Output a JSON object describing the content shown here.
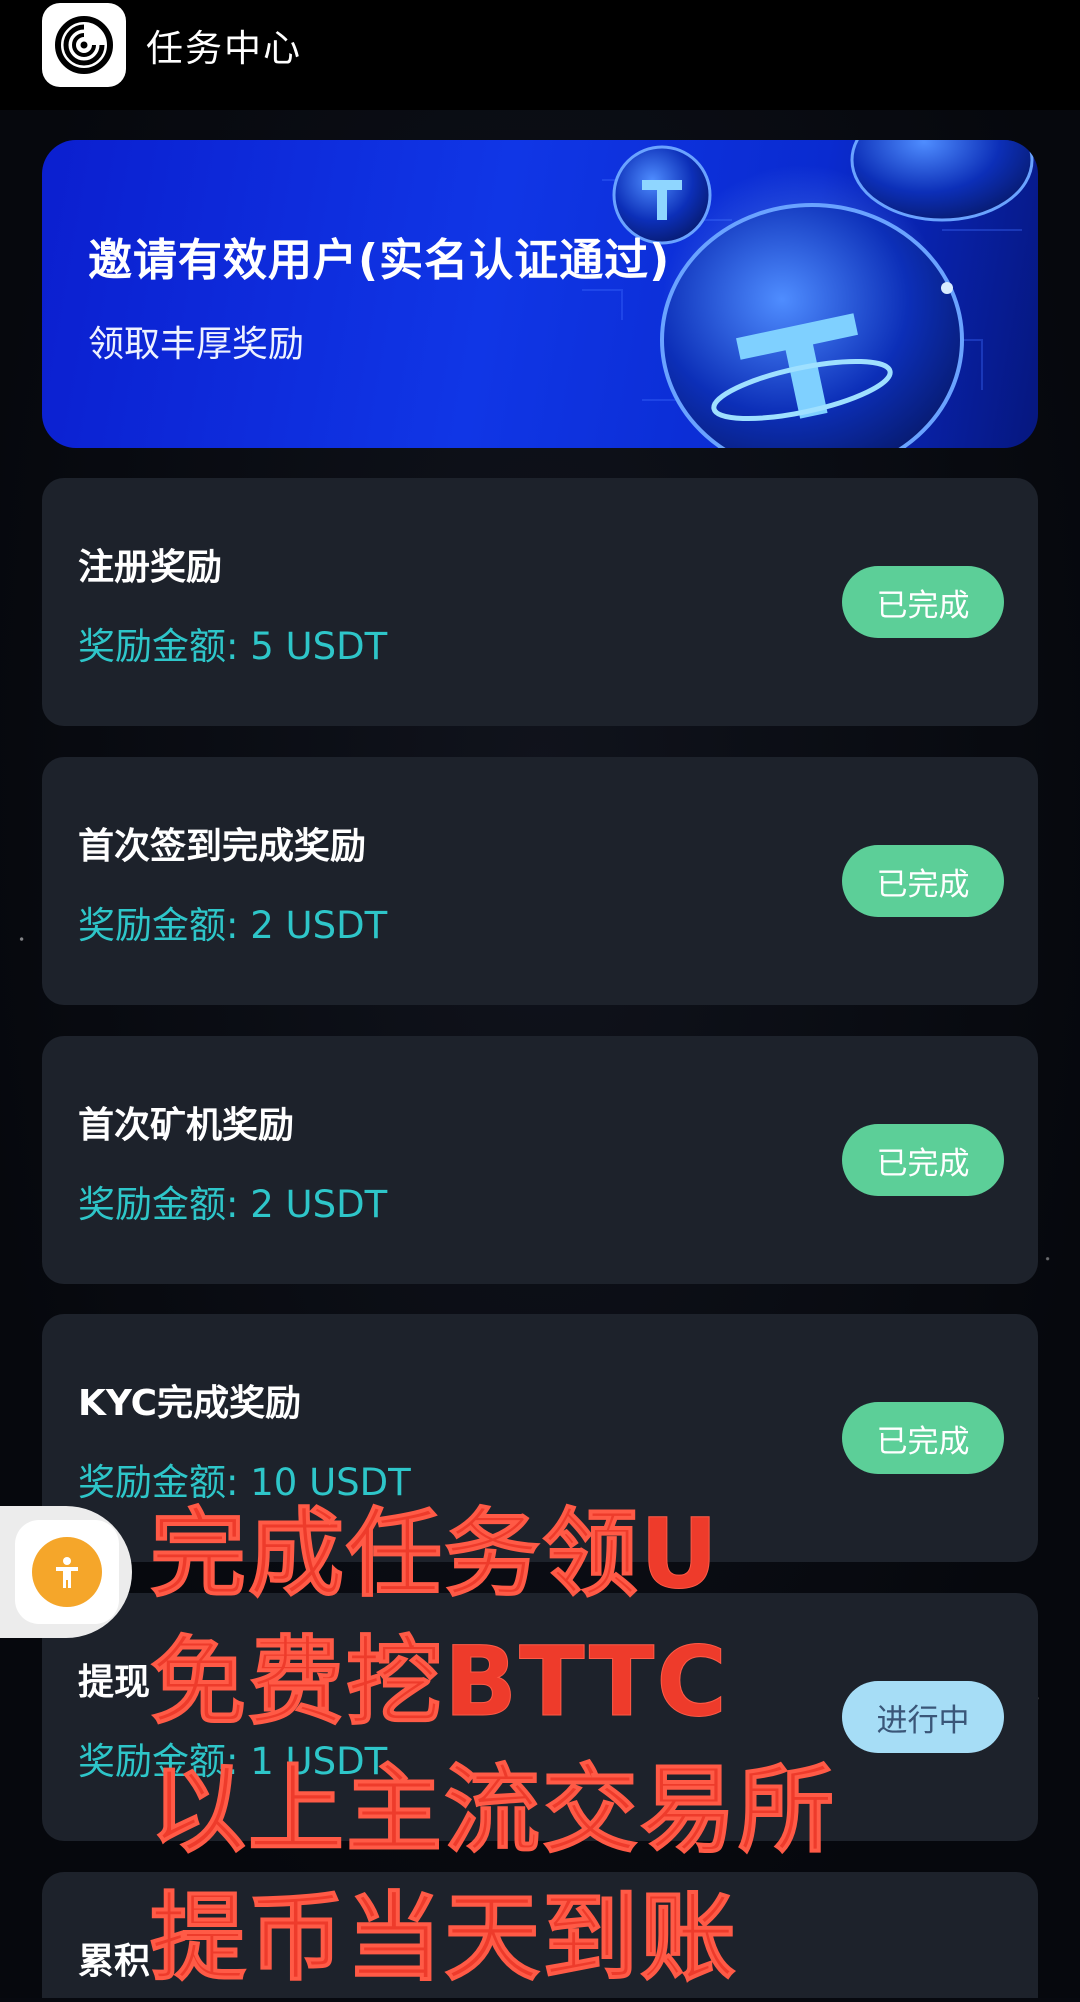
{
  "header": {
    "title": "任务中心",
    "logo_icon": "app-logo-icon"
  },
  "banner": {
    "title": "邀请有效用户(实名认证通过)",
    "subtitle": "领取丰厚奖励"
  },
  "tasks": [
    {
      "title": "注册奖励",
      "reward": "奖励金额: 5 USDT",
      "status": "已完成",
      "status_type": "done"
    },
    {
      "title": "首次签到完成奖励",
      "reward": "奖励金额: 2 USDT",
      "status": "已完成",
      "status_type": "done"
    },
    {
      "title": "首次矿机奖励",
      "reward": "奖励金额: 2 USDT",
      "status": "已完成",
      "status_type": "done"
    },
    {
      "title": "KYC完成奖励",
      "reward": "奖励金额: 10 USDT",
      "status": "已完成",
      "status_type": "done"
    },
    {
      "title": "提现",
      "reward": "奖励金额: 1 USDT",
      "status": "进行中",
      "status_type": "in-progress"
    },
    {
      "title": "累积",
      "reward": "",
      "status": "",
      "status_type": "done"
    }
  ],
  "promo": {
    "line1": "完成任务领U",
    "line2": "免费挖BTTC",
    "line3": "以上主流交易所",
    "line4": "提币当天到账"
  },
  "float_button": {
    "icon": "accessibility-icon"
  },
  "colors": {
    "card_bg": "#1d222b",
    "reward_text": "#2ec6c9",
    "badge_done": "#5ccf98",
    "badge_progress": "#a6ddf6",
    "promo_text": "#ee3b2b",
    "banner_blue": "#1036e6"
  }
}
